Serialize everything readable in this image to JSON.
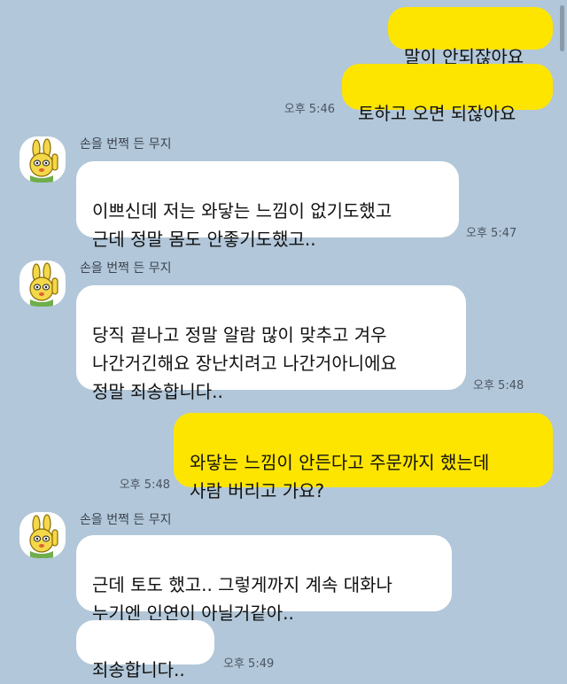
{
  "messages": {
    "m1": {
      "text": "말이 안되잖아요"
    },
    "m2": {
      "text": "토하고 오면 되잖아요",
      "time": "오후 5:46"
    },
    "g1": {
      "sender": "손을 번쩍 든 무지",
      "text": "이쁘신데 저는 와닿는 느낌이 없기도했고\n근데 정말 몸도 안좋기도했고..",
      "time": "오후 5:47"
    },
    "g2": {
      "sender": "손을 번쩍 든 무지",
      "text": "당직 끝나고 정말 알람 많이 맞추고 겨우\n나간거긴해요 장난치려고 나간거아니에요\n정말 죄송합니다..",
      "time": "오후 5:48"
    },
    "m3": {
      "text": "와닿는 느낌이 안든다고 주문까지 했는데\n사람 버리고 가요?",
      "time": "오후 5:48"
    },
    "g3": {
      "sender": "손을 번쩍 든 무지",
      "text": "근데 토도 했고.. 그렇게까지 계속 대화나\n누기엔 인연이 아닐거같아..",
      "text2": "죄송합니다..",
      "time": "오후 5:49"
    }
  },
  "colors": {
    "background": "#b2c7d9",
    "outgoing_bubble": "#fee500",
    "incoming_bubble": "#ffffff"
  },
  "icons": {
    "avatar": "muzi-character-icon"
  }
}
